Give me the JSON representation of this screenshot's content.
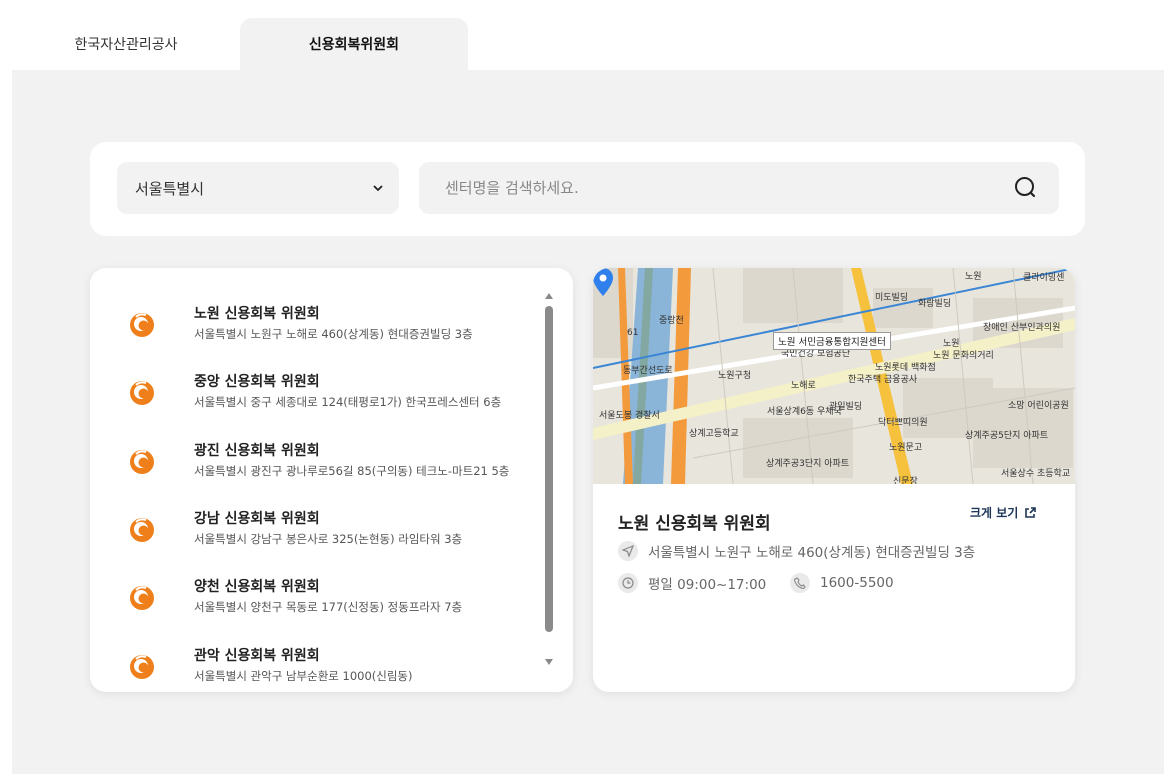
{
  "tabs": [
    {
      "label": "한국자산관리공사"
    },
    {
      "label": "신용회복위원회"
    }
  ],
  "search": {
    "region_value": "서울특별시",
    "placeholder": "센터명을 검색하세요."
  },
  "centers": [
    {
      "name": "노원 신용회복 위원회",
      "address": "서울특별시 노원구 노해로 460(상계동) 현대증권빌딩 3층"
    },
    {
      "name": "중앙 신용회복 위원회",
      "address": "서울특별시 중구 세종대로 124(태평로1가) 한국프레스센터 6층"
    },
    {
      "name": "광진 신용회복 위원회",
      "address": "서울특별시 광진구 광나루로56길 85(구의동) 테크노-마트21 5층"
    },
    {
      "name": "강남 신용회복 위원회",
      "address": "서울특별시 강남구 봉은사로 325(논현동) 라임타워 3층"
    },
    {
      "name": "양천 신용회복 위원회",
      "address": "서울특별시 양천구 목동로 177(신정동) 정동프라자 7층"
    },
    {
      "name": "관악 신용회복 위원회",
      "address": "서울특별시 관악구 남부순환로 1000(신림동)"
    }
  ],
  "detail": {
    "title": "노원 신용회복 위원회",
    "enlarge_label": "크게 보기",
    "address": "서울특별시 노원구 노해로 460(상계동) 현대증권빌딩 3층",
    "hours": "평일 09:00~17:00",
    "phone": "1600-5500"
  },
  "map": {
    "callout": "노원 서민금융통합지원센터",
    "labels": {
      "nowon_gu_office": "노원구청",
      "nowon_road": "노해로",
      "gwangil_building": "광일빌딩",
      "midobilding": "미도빌딩",
      "hwarang_building": "화랑빌딩",
      "jangaein_center": "장애인 산부인과의원",
      "nowon_cultural_street": "노원 문화의거리",
      "sanggye_post": "서울상계6동 우체국",
      "seoul_dobong_police": "서울도봉 경찰서",
      "sanggye_high": "상계고등학교",
      "sanggye_apt_3": "상계주공3단지 아파트",
      "sanggye_apt_5": "상계주공5단지 아파트",
      "national_health": "국민건강 보험공단",
      "korea_finance": "한국주택 금융공사",
      "lotte": "노원롯데 백화점",
      "club_center": "클라이밍센",
      "sobang": "소망 어린이공원",
      "doctor_clinic": "닥터쁘띠의원",
      "nowon_mungo": "노원문고",
      "nowon_station": "노원",
      "nowon_station_2": "노원",
      "seoul_sanggye": "서울상수 초등학교",
      "sinmun": "신문장",
      "route_61": "61",
      "dongbu_expressway": "동부간선도로",
      "jungnangcheon": "중랑천"
    },
    "colors": {
      "river": "#8ab4d8",
      "expressway": "#f39a3c",
      "main_road": "#f6c23e",
      "subway": "#3a86d4",
      "pin": "#2f80ed"
    }
  },
  "icons": {
    "logo": "orange-swirl-logo-icon",
    "chevron": "chevron-down-icon",
    "search": "search-icon",
    "external": "external-link-icon",
    "location": "location-arrow-icon",
    "clock": "clock-icon",
    "phone": "phone-icon"
  }
}
